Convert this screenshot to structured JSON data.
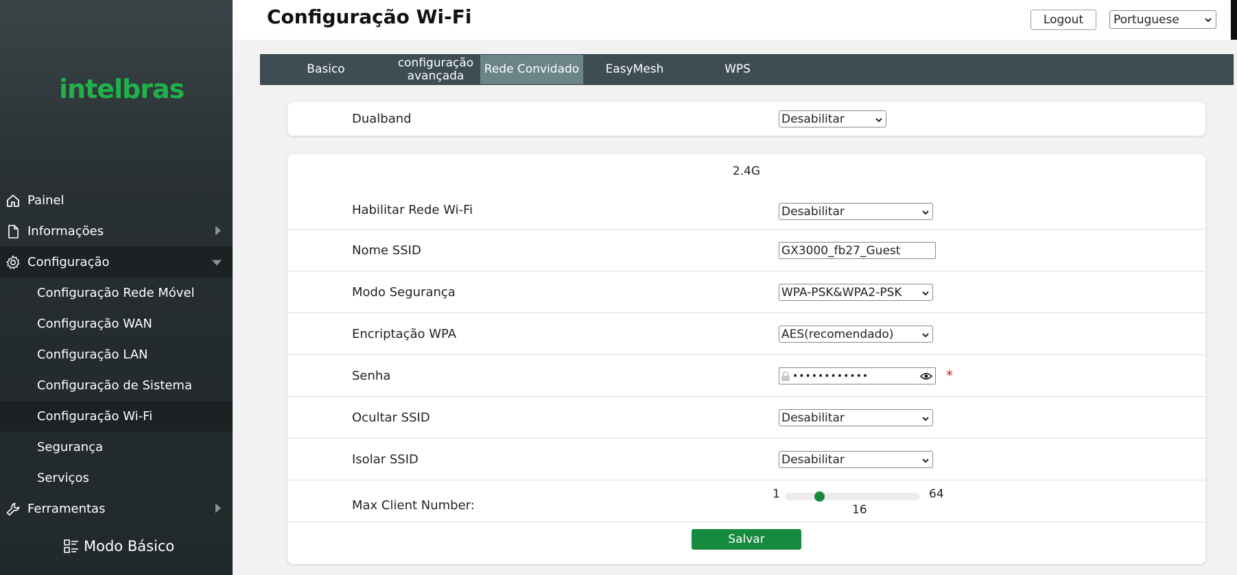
{
  "brand": {
    "logo_text": "intelbras",
    "logo_color": "#1fb24a"
  },
  "sidebar": {
    "items": [
      {
        "label": "Painel",
        "icon": "home-icon"
      },
      {
        "label": "Informações",
        "icon": "document-icon",
        "has_arrow": true
      },
      {
        "label": "Configuração",
        "icon": "gear-icon",
        "expanded": true
      },
      {
        "label": "Configuração Rede Móvel"
      },
      {
        "label": "Configuração WAN"
      },
      {
        "label": "Configuração LAN"
      },
      {
        "label": "Configuração de Sistema"
      },
      {
        "label": "Configuração Wi-Fi",
        "active": true
      },
      {
        "label": "Segurança"
      },
      {
        "label": "Serviços"
      },
      {
        "label": "Ferramentas",
        "icon": "wrench-icon",
        "has_arrow": true
      }
    ],
    "mode_label": "Modo Básico"
  },
  "header": {
    "title": "Configuração Wi-Fi",
    "logout_label": "Logout",
    "language": "Portuguese"
  },
  "tabs": [
    {
      "label": "Basico"
    },
    {
      "label": "configuração avançada"
    },
    {
      "label": "Rede Convidado",
      "active": true
    },
    {
      "label": "EasyMesh"
    },
    {
      "label": "WPS"
    }
  ],
  "dualband": {
    "label": "Dualband",
    "value": "Desabilitar"
  },
  "band": {
    "title": "2.4G",
    "enable": {
      "label": "Habilitar Rede Wi-Fi",
      "value": "Desabilitar"
    },
    "ssid": {
      "label": "Nome SSID",
      "value": "GX3000_fb27_Guest"
    },
    "security_mode": {
      "label": "Modo Segurança",
      "value": "WPA-PSK&WPA2-PSK"
    },
    "wpa_encryption": {
      "label": "Encriptação WPA",
      "value": "AES(recomendado)"
    },
    "password": {
      "label": "Senha",
      "masked": "••••••••••••",
      "required_mark": "*"
    },
    "hide_ssid": {
      "label": "Ocultar SSID",
      "value": "Desabilitar"
    },
    "isolate_ssid": {
      "label": "Isolar SSID",
      "value": "Desabilitar"
    },
    "max_clients": {
      "label": "Max Client Number:",
      "min": "1",
      "max": "64",
      "value": "16"
    },
    "save_label": "Salvar"
  },
  "colors": {
    "accent_green": "#168a3e",
    "tab_active": "#6b8487",
    "tab_bar": "#3e4d54"
  }
}
